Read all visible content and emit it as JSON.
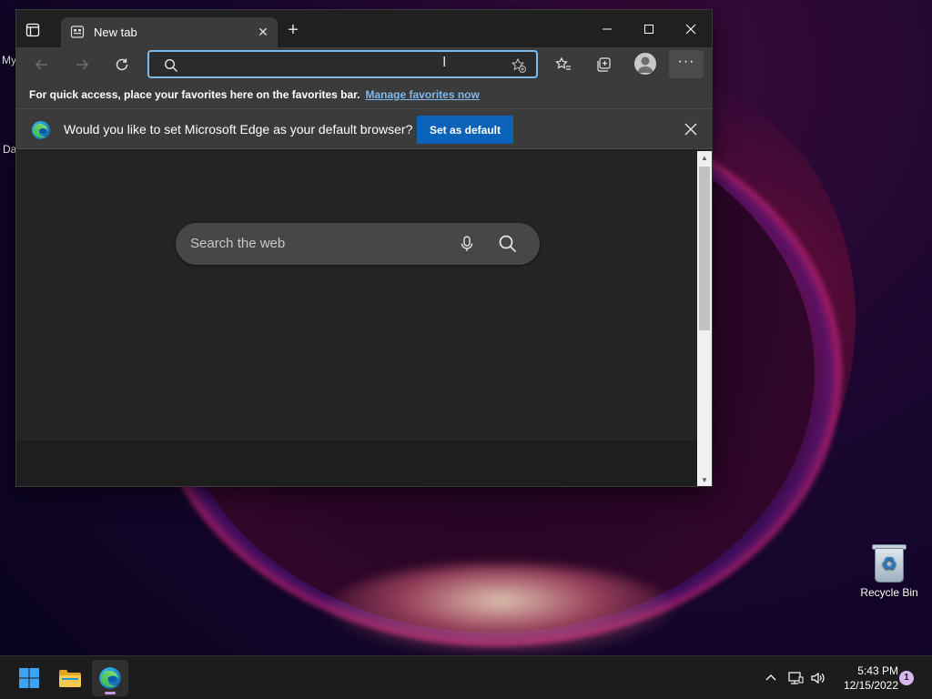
{
  "desktop": {
    "partial_labels": [
      "My",
      "Da"
    ],
    "recycle_bin_label": "Recycle Bin"
  },
  "browser": {
    "tab": {
      "title": "New tab"
    },
    "address_bar": {
      "value": "",
      "placeholder": ""
    },
    "favorites_bar": {
      "text": "For quick access, place your favorites here on the favorites bar.",
      "link": "Manage favorites now"
    },
    "infobar": {
      "text": "Would you like to set Microsoft Edge as your default browser?",
      "button": "Set as default"
    },
    "new_tab_page": {
      "search_placeholder": "Search the web"
    }
  },
  "taskbar": {
    "apps": [
      {
        "name": "Start",
        "icon": "windows-logo-icon"
      },
      {
        "name": "File Explorer",
        "icon": "folder-icon"
      },
      {
        "name": "Microsoft Edge",
        "icon": "edge-icon",
        "active": true
      }
    ],
    "clock": {
      "time": "5:43 PM",
      "date": "12/15/2022"
    },
    "notifications": "1"
  },
  "colors": {
    "accent": "#0a63b8",
    "link": "#7fb9ec",
    "window_bg": "#202020",
    "toolbar_bg": "#3b3b3b"
  }
}
